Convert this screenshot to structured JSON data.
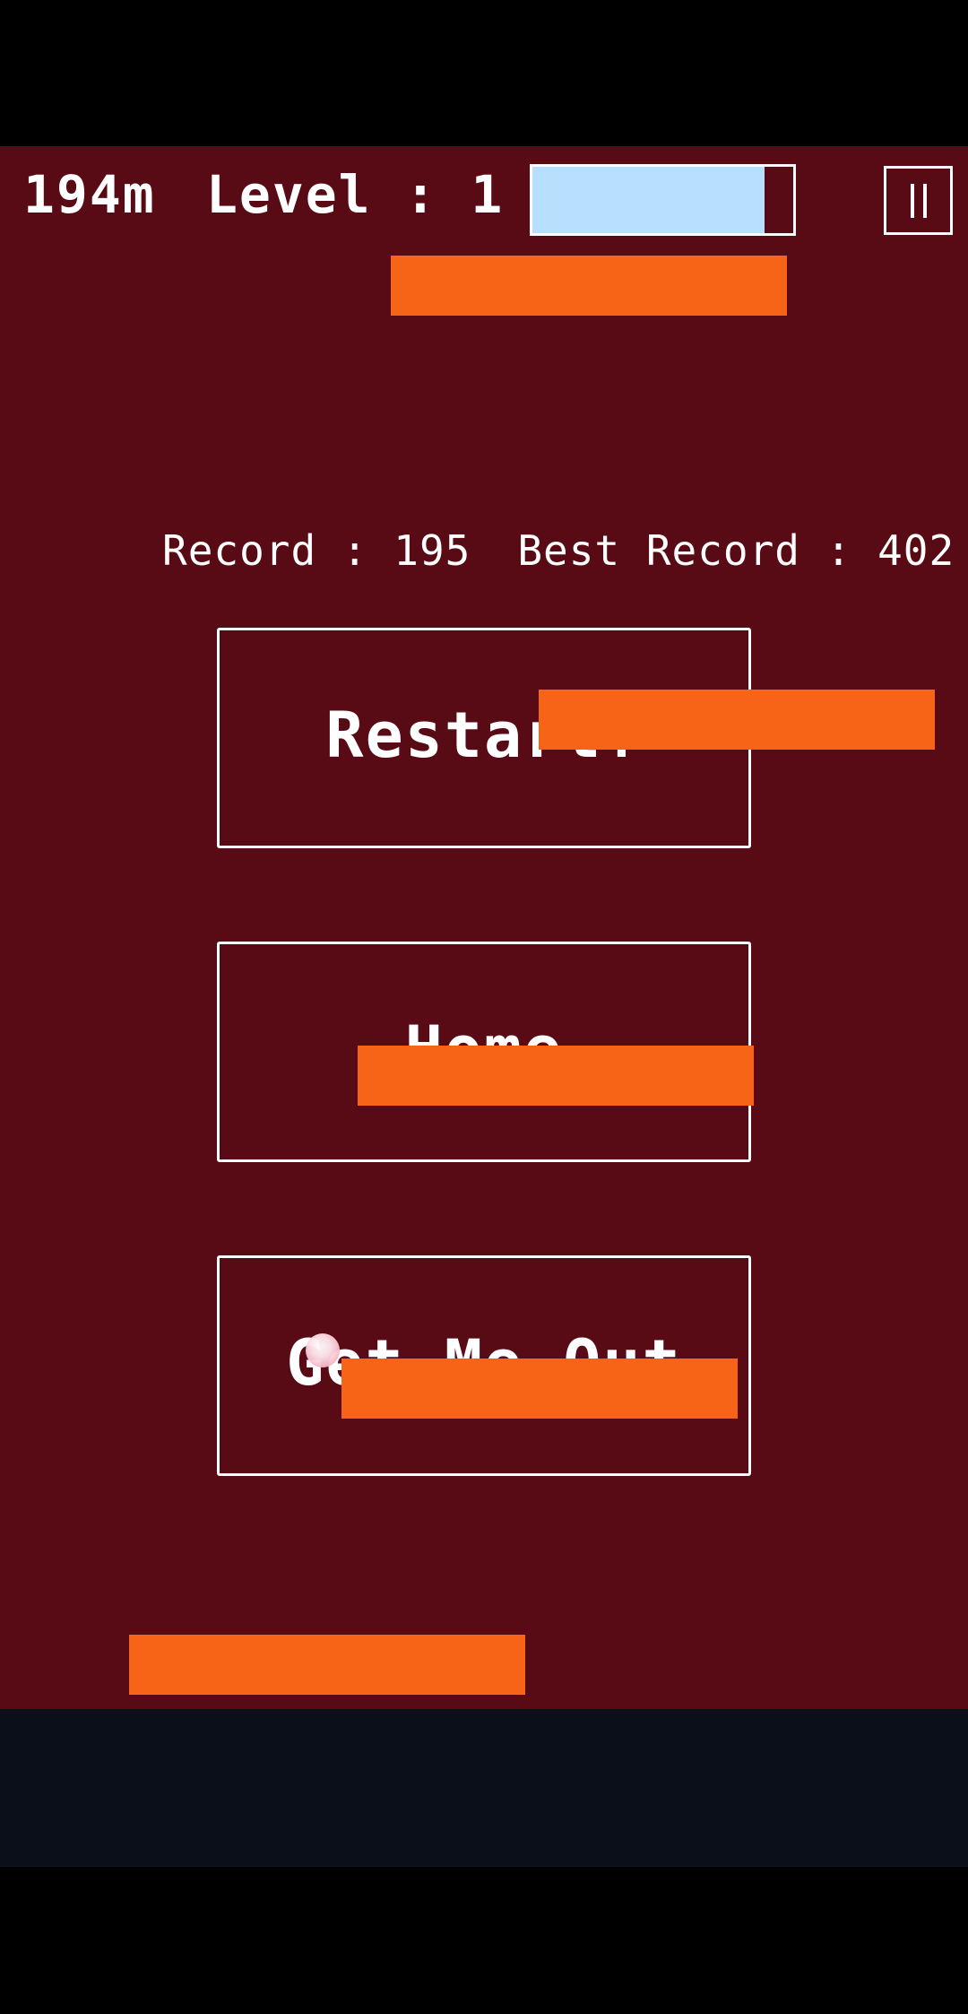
{
  "hud": {
    "distance": "194m",
    "level": "Level : 1",
    "progress_fraction": 0.89
  },
  "records": {
    "record": "Record : 195",
    "best_record": "Best Record : 402"
  },
  "menu": {
    "restart_label": "Restart!",
    "home_label": "Home",
    "exit_label": "Get Me Out"
  },
  "icons": {
    "pause": "pause-icon"
  },
  "colors": {
    "game_background": "#580B14",
    "platform": "#F76418",
    "progress_fill": "#B7E0FF",
    "nav_bar": "#0B0F1A",
    "text": "#FFFFFF"
  }
}
